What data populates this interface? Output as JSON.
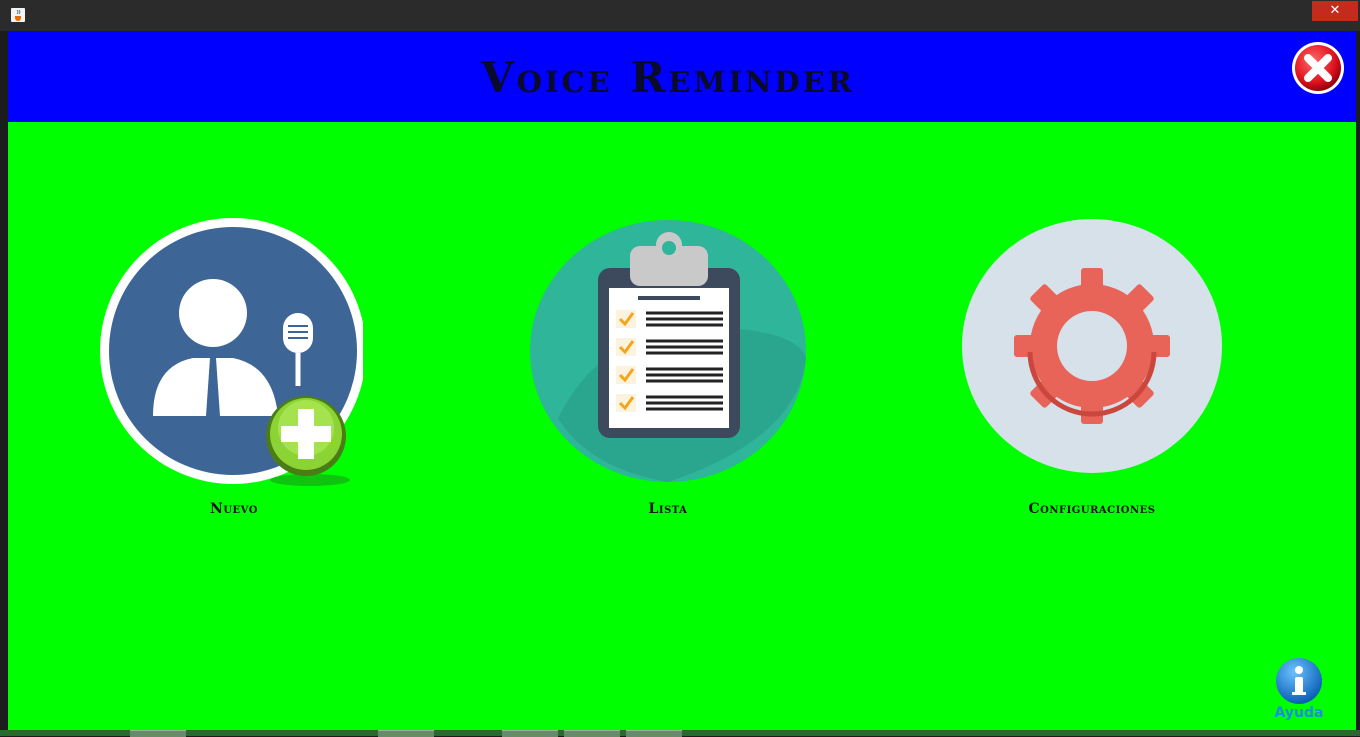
{
  "window": {
    "app_icon": "java-icon",
    "close_glyph": "✕"
  },
  "header": {
    "title": "Voice Reminder",
    "exit_icon": "red-close-icon",
    "bg_color": "#0000ff"
  },
  "main": {
    "bg_color": "#00ff00",
    "tiles": [
      {
        "label": "Nuevo",
        "icon": "user-microphone-add-icon"
      },
      {
        "label": "Lista",
        "icon": "clipboard-checklist-icon"
      },
      {
        "label": "Configuraciones",
        "icon": "gear-icon"
      }
    ],
    "help": {
      "label": "Ayuda",
      "icon": "info-icon"
    }
  }
}
